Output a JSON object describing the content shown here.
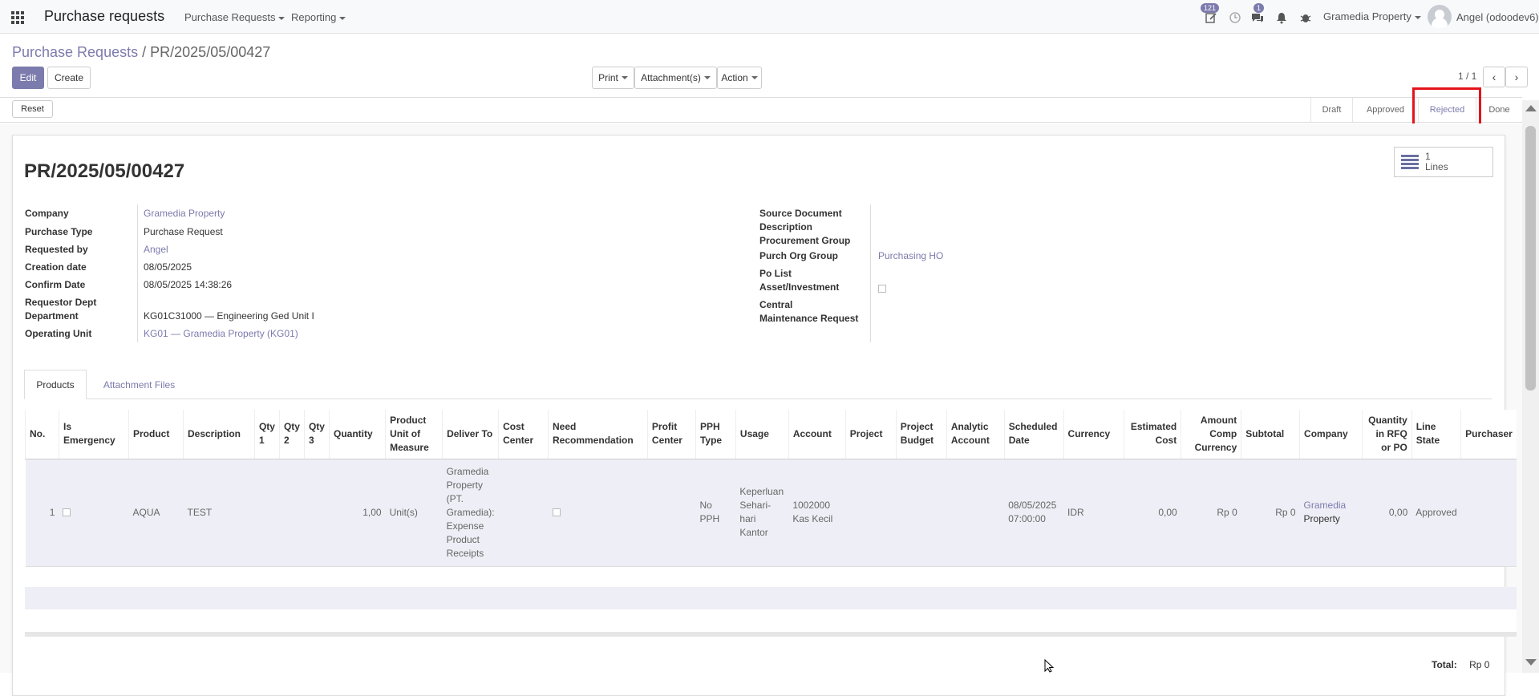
{
  "navbar": {
    "app_title": "Purchase requests",
    "menus": [
      "Purchase Requests",
      "Reporting"
    ],
    "activity_badge": "121",
    "messages_badge": "1",
    "company": "Gramedia Property",
    "user": "Angel (odoodev6)"
  },
  "breadcrumb": {
    "parent": "Purchase Requests",
    "separator": "/",
    "current": "PR/2025/05/00427"
  },
  "actions": {
    "edit": "Edit",
    "create": "Create",
    "print": "Print",
    "attachments": "Attachment(s)",
    "action": "Action"
  },
  "pager": {
    "value": "1 / 1"
  },
  "statusbar": {
    "reset": "Reset",
    "stages": [
      "Draft",
      "Approved",
      "Rejected",
      "Done"
    ],
    "active_stage": "Rejected"
  },
  "smart_button": {
    "count": "1",
    "label": "Lines"
  },
  "record": {
    "title": "PR/2025/05/00427",
    "left": {
      "company_label": "Company",
      "company": "Gramedia Property",
      "purchase_type_label": "Purchase Type",
      "purchase_type": "Purchase Request",
      "requested_by_label": "Requested by",
      "requested_by": "Angel",
      "creation_date_label": "Creation date",
      "creation_date": "08/05/2025",
      "confirm_date_label": "Confirm Date",
      "confirm_date": "08/05/2025 14:38:26",
      "requestor_dept_label": "Requestor Dept",
      "department_label": "Department",
      "department": "KG01C31000 — Engineering Ged Unit I",
      "operating_unit_label": "Operating Unit",
      "operating_unit": "KG01 — Gramedia Property (KG01)"
    },
    "right": {
      "source_document_label": "Source Document",
      "description_label": "Description",
      "procurement_group_label": "Procurement Group",
      "purch_org_group_label": "Purch Org Group",
      "purch_org_group": "Purchasing HO",
      "po_list_label": "Po List",
      "asset_investment_label": "Asset/Investment",
      "central_label": "Central",
      "maintenance_request_label": "Maintenance Request"
    }
  },
  "tabs": [
    "Products",
    "Attachment Files"
  ],
  "table": {
    "headers": [
      "No.",
      "Is Emergency",
      "Product",
      "Description",
      "Qty 1",
      "Qty 2",
      "Qty 3",
      "Quantity",
      "Product Unit of Measure",
      "Deliver To",
      "Cost Center",
      "Need Recommendation",
      "Profit Center",
      "PPH Type",
      "Usage",
      "Account",
      "Project",
      "Project Budget",
      "Analytic Account",
      "Scheduled Date",
      "Currency",
      "Estimated Cost",
      "Amount Comp Currency",
      "Subtotal",
      "Company",
      "Quantity in RFQ or PO",
      "Line State",
      "Purchaser"
    ],
    "rows": [
      {
        "no": "1",
        "product": "AQUA",
        "description": "TEST",
        "qty1": "",
        "qty2": "",
        "qty3": "",
        "quantity": "1,00",
        "uom": "Unit(s)",
        "deliver_to": "Gramedia Property (PT. Gramedia): Expense Product Receipts",
        "cost_center": "",
        "profit_center": "",
        "pph_type": "No PPH",
        "usage": "Keperluan Sehari-hari Kantor",
        "account": "1002000 Kas Kecil",
        "project": "",
        "project_budget": "",
        "analytic_account": "",
        "scheduled_date": "08/05/2025 07:00:00",
        "currency": "IDR",
        "estimated_cost": "0,00",
        "amount_comp": "Rp 0",
        "subtotal": "Rp 0",
        "company_link": "Gramedia",
        "company_rest": "Property",
        "qty_rfq": "0,00",
        "line_state": "Approved",
        "purchaser": ""
      }
    ]
  },
  "total": {
    "label": "Total:",
    "value": "Rp 0"
  },
  "colors": {
    "accent": "#7c7bad",
    "highlight": "#e3141b"
  }
}
